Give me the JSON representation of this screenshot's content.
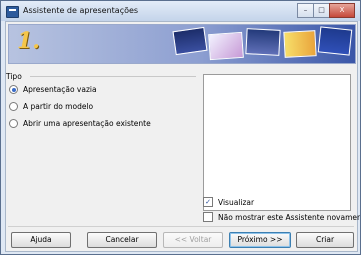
{
  "window": {
    "title": "Assistente de apresentações",
    "controls": {
      "minimize": "–",
      "maximize": "□",
      "close": "X"
    }
  },
  "banner": {
    "step": "1."
  },
  "tipo": {
    "label": "Tipo",
    "options": [
      {
        "label": "Apresentação vazia",
        "selected": true
      },
      {
        "label": "A partir do modelo",
        "selected": false
      },
      {
        "label": "Abrir uma apresentação existente",
        "selected": false
      }
    ]
  },
  "preview_check": {
    "label": "Visualizar",
    "checked": true
  },
  "dont_show_check": {
    "label": "Não mostrar este Assistente novamente",
    "checked": false
  },
  "buttons": {
    "help": "Ajuda",
    "cancel": "Cancelar",
    "back": "<< Voltar",
    "next": "Próximo >>",
    "create": "Criar"
  },
  "colors": {
    "accent": "#3a6cc8",
    "banner_dark": "#3a56a8",
    "step_number": "#f5c64a"
  }
}
